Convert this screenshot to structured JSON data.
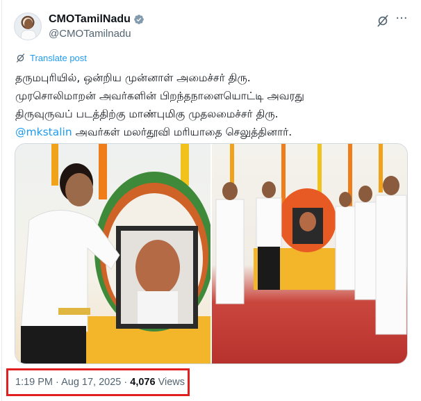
{
  "author": {
    "display_name": "CMOTamilNadu",
    "handle": "@CMOTamilnadu",
    "verified": true
  },
  "icons": {
    "verified": "verified-badge-icon",
    "grok": "grok-icon",
    "more": "more-icon",
    "translate": "translate-icon"
  },
  "translate": {
    "label": "Translate post"
  },
  "tweet": {
    "lines": [
      "தருமபுரியில், ஒன்றிய முன்னாள் அமைச்சர் திரு.",
      "முரசொலிமாறன் அவர்களின் பிறந்தநாளையொட்டி அவரது",
      "திருவுருவப் படத்திற்கு மாண்புமிகு முதலமைச்சர் திரு."
    ],
    "mention": "@mkstalin",
    "last_line_rest": " அவர்கள் மலர்தூவி மரியாதை செலுத்தினார்."
  },
  "meta": {
    "time": "1:19 PM",
    "separator": " · ",
    "date": "Aug 17, 2025",
    "views_count": "4,076",
    "views_label": " Views"
  },
  "colors": {
    "accent": "#1d9bf0",
    "secondary_text": "#536471",
    "highlight_box": "#e02020",
    "verified_fill": "#829aab"
  }
}
